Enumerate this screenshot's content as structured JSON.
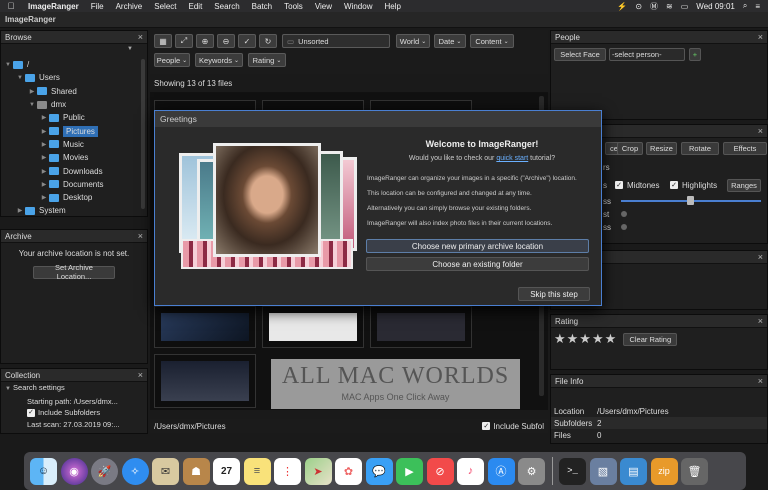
{
  "menubar": {
    "app": "ImageRanger",
    "items": [
      "File",
      "Archive",
      "Select",
      "Edit",
      "Search",
      "Batch",
      "Tools",
      "View",
      "Window",
      "Help"
    ],
    "clock": "Wed 09:01"
  },
  "window": {
    "title": "ImageRanger"
  },
  "browse": {
    "title": "Browse",
    "tree": [
      {
        "label": "/",
        "indent": 0
      },
      {
        "label": "Users",
        "indent": 1
      },
      {
        "label": "Shared",
        "indent": 2
      },
      {
        "label": "dmx",
        "indent": 2
      },
      {
        "label": "Public",
        "indent": 3
      },
      {
        "label": "Pictures",
        "indent": 3
      },
      {
        "label": "Music",
        "indent": 3
      },
      {
        "label": "Movies",
        "indent": 3
      },
      {
        "label": "Downloads",
        "indent": 3
      },
      {
        "label": "Documents",
        "indent": 3
      },
      {
        "label": "Desktop",
        "indent": 3
      },
      {
        "label": "System",
        "indent": 1
      }
    ]
  },
  "archive": {
    "title": "Archive",
    "message": "Your archive location is not set.",
    "button": "Set Archive Location..."
  },
  "collection": {
    "title": "Collection",
    "search_settings": "Search settings",
    "starting_path": "Starting path: /Users/dmx...",
    "include_subfolders": "Include Subfolders",
    "last_scan": "Last scan: 27.03.2019 09:..."
  },
  "toolbar": {
    "unsorted": "Unsorted",
    "world": "World",
    "date": "Date",
    "content": "Content",
    "people": "People",
    "keywords": "Keywords",
    "rating": "Rating"
  },
  "grid": {
    "showing": "Showing 13 of 13 files"
  },
  "statusbar": {
    "path": "/Users/dmx/Pictures",
    "include_subfolders": "Include Subfol"
  },
  "dialog": {
    "title": "Greetings",
    "heading": "Welcome to ImageRanger!",
    "question_pre": "Would you like to check our ",
    "question_link": "quick start",
    "question_post": " tutorial?",
    "p1": "ImageRanger can organize your images in a specific (\"Archive\") location.",
    "p2": "This location can be configured and changed at any time.",
    "p3": "Alternatively you can simply browse your existing folders.",
    "p4": "ImageRanger will also index photo files in their current locations.",
    "btn_new": "Choose new primary archive location",
    "btn_existing": "Choose an existing folder",
    "btn_skip": "Skip this step"
  },
  "people": {
    "title": "People",
    "select_face": "Select Face",
    "select_person": "-select person-"
  },
  "edit": {
    "tools": [
      "ce",
      "Crop",
      "Resize",
      "Rotate",
      "Effects"
    ],
    "rs": "rs",
    "s": "s",
    "midtones": "Midtones",
    "highlights": "Highlights",
    "ranges": "Ranges",
    "ss1": "ss",
    "st": "st",
    "ss2": "ss"
  },
  "rating": {
    "title": "Rating",
    "stars": "★★★★★",
    "clear": "Clear Rating"
  },
  "fileinfo": {
    "title": "File Info",
    "rows": [
      {
        "k": "Location",
        "v": "/Users/dmx/Pictures"
      },
      {
        "k": "Subfolders",
        "v": "2"
      },
      {
        "k": "Files",
        "v": "0"
      }
    ]
  },
  "watermark": {
    "line1": "ALL MAC WORLDS",
    "line2": "MAC Apps One Click Away"
  },
  "dock": {
    "apps": [
      "finder-icon",
      "siri-icon",
      "launchpad-icon",
      "safari-icon",
      "mail-icon",
      "contacts-icon",
      "calendar-icon",
      "notes-icon",
      "reminders-icon",
      "maps-icon",
      "photos-icon",
      "messages-icon",
      "facetime-icon",
      "news-icon",
      "music-icon",
      "appstore-icon",
      "system-preferences-icon",
      "terminal-icon",
      "preview-icon",
      "imageranger-icon",
      "archive-zip-icon",
      "trash-icon"
    ],
    "calendar_day": "27",
    "zip_label": "zip"
  }
}
